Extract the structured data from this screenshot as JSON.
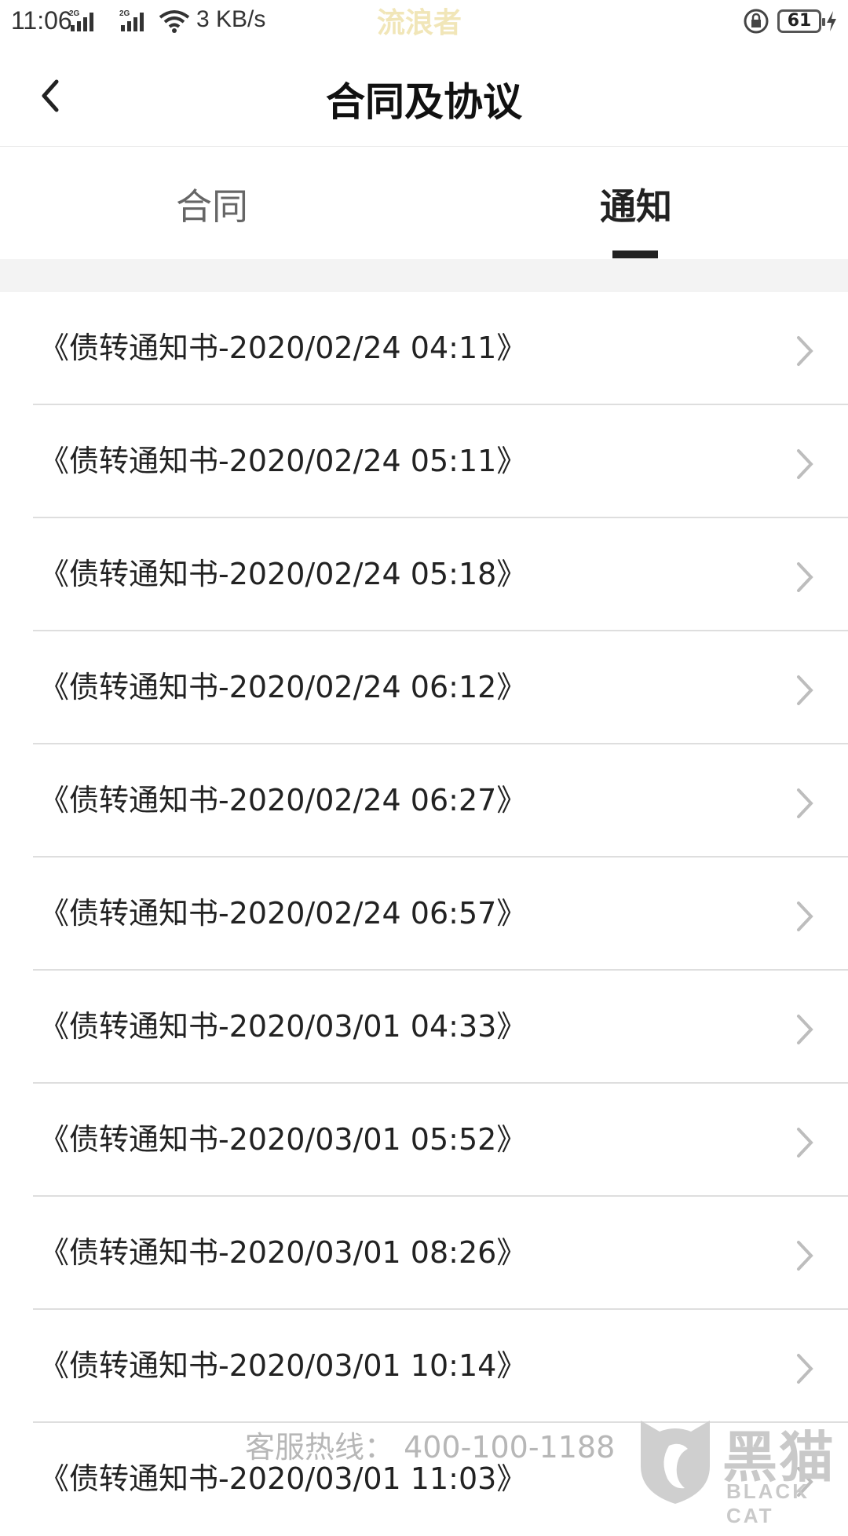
{
  "status_bar": {
    "time": "11:06",
    "network_speed": "3 KB/s",
    "watermark": "流浪者",
    "battery": "61",
    "icons": [
      "signal-2g-icon",
      "signal-2g-icon",
      "wifi-icon",
      "lock-rotation-icon",
      "battery-icon",
      "charging-icon"
    ]
  },
  "header": {
    "title": "合同及协议",
    "back_icon": "chevron-left-icon"
  },
  "tabs": [
    {
      "label": "合同",
      "active": false
    },
    {
      "label": "通知",
      "active": true
    }
  ],
  "list": {
    "items": [
      {
        "label": "《债转通知书-2020/02/24 04:11》"
      },
      {
        "label": "《债转通知书-2020/02/24 05:11》"
      },
      {
        "label": "《债转通知书-2020/02/24 05:18》"
      },
      {
        "label": "《债转通知书-2020/02/24 06:12》"
      },
      {
        "label": "《债转通知书-2020/02/24 06:27》"
      },
      {
        "label": "《债转通知书-2020/02/24 06:57》"
      },
      {
        "label": "《债转通知书-2020/03/01 04:33》"
      },
      {
        "label": "《债转通知书-2020/03/01 05:52》"
      },
      {
        "label": "《债转通知书-2020/03/01 08:26》"
      },
      {
        "label": "《债转通知书-2020/03/01 10:14》"
      },
      {
        "label": "《债转通知书-2020/03/01 11:03》"
      }
    ],
    "chevron_icon": "chevron-right-icon"
  },
  "overlay": {
    "hotline": "客服热线： 400-100-1188",
    "brand_name": "黑猫",
    "brand_sub": "BLACK CAT"
  },
  "colors": {
    "text": "#222222",
    "muted": "#666666",
    "divider": "#dedede",
    "gap": "#f3f3f3",
    "tab_indicator": "#222222"
  }
}
